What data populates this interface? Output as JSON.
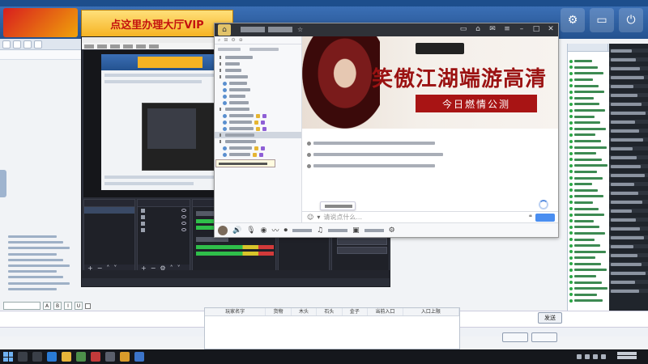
{
  "hall": {
    "vip_banner": "点这里办理大厅VIP",
    "top_icons": [
      "gear-icon",
      "display-icon",
      "power-icon"
    ],
    "colors": {
      "header": "#2f64a6",
      "vip": "#f6b323",
      "vip_text": "#c4120f"
    }
  },
  "live": {
    "promo_title": "笑傲江湖端游高清",
    "promo_sub": "今日燃情公测",
    "chat_placeholder": "请说点什么..."
  },
  "results": {
    "columns": [
      "玩家名字",
      "货物",
      "木头",
      "石头",
      "金子",
      "当前入口",
      "入口上限"
    ]
  },
  "footer": {
    "send_label": "发送"
  }
}
